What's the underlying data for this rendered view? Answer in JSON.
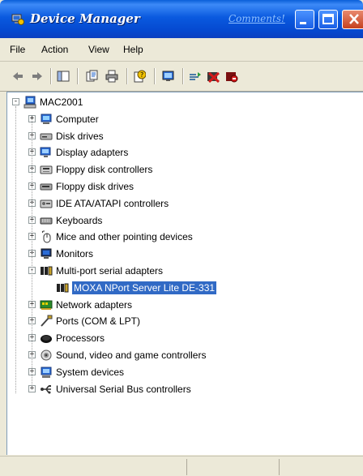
{
  "window": {
    "title": "Device Manager",
    "comments_link": "Comments!"
  },
  "menubar": [
    "File",
    "Action",
    "View",
    "Help"
  ],
  "tree": {
    "root": "MAC2001",
    "items": [
      {
        "label": "Computer",
        "icon": "computer-icon",
        "expanded": false
      },
      {
        "label": "Disk drives",
        "icon": "disk-drive-icon",
        "expanded": false
      },
      {
        "label": "Display adapters",
        "icon": "display-adapter-icon",
        "expanded": false
      },
      {
        "label": "Floppy disk controllers",
        "icon": "floppy-controller-icon",
        "expanded": false
      },
      {
        "label": "Floppy disk drives",
        "icon": "floppy-drive-icon",
        "expanded": false
      },
      {
        "label": "IDE ATA/ATAPI controllers",
        "icon": "ide-controller-icon",
        "expanded": false
      },
      {
        "label": "Keyboards",
        "icon": "keyboard-icon",
        "expanded": false
      },
      {
        "label": "Mice and other pointing devices",
        "icon": "mouse-icon",
        "expanded": false
      },
      {
        "label": "Monitors",
        "icon": "monitor-icon",
        "expanded": false
      },
      {
        "label": "Multi-port serial adapters",
        "icon": "serial-adapter-icon",
        "expanded": true,
        "children": [
          {
            "label": "MOXA NPort Server Lite DE-331",
            "icon": "serial-adapter-icon",
            "selected": true
          }
        ]
      },
      {
        "label": "Network adapters",
        "icon": "network-adapter-icon",
        "expanded": false
      },
      {
        "label": "Ports (COM & LPT)",
        "icon": "port-icon",
        "expanded": false
      },
      {
        "label": "Processors",
        "icon": "processor-icon",
        "expanded": false
      },
      {
        "label": "Sound, video and game controllers",
        "icon": "sound-icon",
        "expanded": false
      },
      {
        "label": "System devices",
        "icon": "system-device-icon",
        "expanded": false
      },
      {
        "label": "Universal Serial Bus controllers",
        "icon": "usb-icon",
        "expanded": false
      }
    ]
  },
  "colors": {
    "title_bar": "#0a5adf",
    "selection": "#316ac5",
    "face": "#ece9d8"
  }
}
